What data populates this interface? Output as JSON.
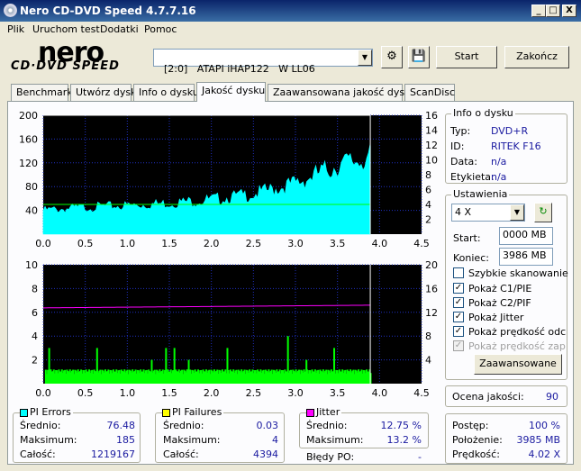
{
  "window": {
    "title": "Nero CD-DVD Speed 4.7.7.16",
    "btn_min": "_",
    "btn_max": "□",
    "btn_close": "X"
  },
  "menu": [
    "Plik",
    "Uruchom test",
    "Dodatki",
    "Pomoc"
  ],
  "logo": {
    "text": "nero",
    "subtext": "CD·DVD SPEED"
  },
  "toolbar": {
    "drive": "[2:0]   ATAPI iHAP122   W LL06",
    "start": "Start",
    "stop": "Zakończ"
  },
  "tabs": [
    "Benchmark",
    "Utwórz dysk",
    "Info o dysku",
    "Jakość dysku",
    "Zaawansowana jakość dysku",
    "ScanDisc"
  ],
  "active_tab": "Jakość dysku",
  "disc_info": {
    "title": "Info o dysku",
    "rows": [
      {
        "label": "Typ:",
        "value": "DVD+R"
      },
      {
        "label": "ID:",
        "value": "RITEK F16"
      },
      {
        "label": "Data:",
        "value": "n/a"
      },
      {
        "label": "Etykieta:",
        "value": "n/a"
      }
    ]
  },
  "settings": {
    "title": "Ustawienia",
    "speed": "4 X",
    "start_label": "Start:",
    "start_value": "0000 MB",
    "end_label": "Koniec:",
    "end_value": "3986 MB",
    "checks": [
      {
        "label": "Szybkie skanowanie",
        "checked": false,
        "disabled": false
      },
      {
        "label": "Pokaż C1/PIE",
        "checked": true,
        "disabled": false
      },
      {
        "label": "Pokaż C2/PIF",
        "checked": true,
        "disabled": false
      },
      {
        "label": "Pokaż Jitter",
        "checked": true,
        "disabled": false
      },
      {
        "label": "Pokaż prędkość odczy",
        "checked": true,
        "disabled": false
      },
      {
        "label": "Pokaż prędkość zapisu",
        "checked": true,
        "disabled": true
      }
    ],
    "advanced": "Zaawansowane"
  },
  "quality": {
    "label": "Ocena jakości:",
    "value": "90"
  },
  "progress": {
    "rows": [
      {
        "label": "Postęp:",
        "value": "100 %"
      },
      {
        "label": "Położenie:",
        "value": "3985 MB"
      },
      {
        "label": "Prędkość:",
        "value": "4.02 X"
      }
    ]
  },
  "pi_errors": {
    "title": "PI Errors",
    "color": "#00ffff",
    "rows": [
      {
        "label": "Średnio:",
        "value": "76.48"
      },
      {
        "label": "Maksimum:",
        "value": "185"
      },
      {
        "label": "Całość:",
        "value": "1219167"
      }
    ]
  },
  "pi_failures": {
    "title": "PI Failures",
    "color": "#ffff00",
    "rows": [
      {
        "label": "Średnio:",
        "value": "0.03"
      },
      {
        "label": "Maksimum:",
        "value": "4"
      },
      {
        "label": "Całość:",
        "value": "4394"
      }
    ]
  },
  "jitter": {
    "title": "Jitter",
    "color": "#ff00ff",
    "rows": [
      {
        "label": "Średnio:",
        "value": "12.75 %"
      },
      {
        "label": "Maksimum:",
        "value": "13.2 %"
      }
    ],
    "po_label": "Błędy PO:",
    "po_value": "-"
  },
  "chart_data": [
    {
      "type": "area",
      "x_ticks": [
        "0.0",
        "0.5",
        "1.0",
        "1.5",
        "2.0",
        "2.5",
        "3.0",
        "3.5",
        "4.0",
        "4.5"
      ],
      "y_left_ticks": [
        "200",
        "160",
        "120",
        "80",
        "40"
      ],
      "y_right_ticks": [
        "16",
        "14",
        "12",
        "10",
        "8",
        "6",
        "4",
        "2"
      ],
      "xlim": [
        0,
        4.5
      ],
      "ylim": [
        0,
        200
      ],
      "y2lim": [
        0,
        16
      ],
      "grid": true,
      "series": [
        {
          "type": "area",
          "color": "#00ffff",
          "x": [
            0,
            0.5,
            1.0,
            1.5,
            2.0,
            2.5,
            3.0,
            3.5,
            3.89
          ],
          "y": [
            40,
            45,
            48,
            52,
            58,
            67,
            85,
            115,
            130
          ]
        },
        {
          "type": "line",
          "color": "#00ff00",
          "axis": "right",
          "x": [
            0,
            3.89
          ],
          "y": [
            4,
            4
          ]
        },
        {
          "type": "line",
          "color": "#ffffff",
          "axis": "right",
          "x": [
            0,
            3.89
          ],
          "y": [
            16,
            16
          ]
        }
      ]
    },
    {
      "type": "bar",
      "x_ticks": [
        "0.0",
        "0.5",
        "1.0",
        "1.5",
        "2.0",
        "2.5",
        "3.0",
        "3.5",
        "4.0",
        "4.5"
      ],
      "y_left_ticks": [
        "10",
        "8",
        "6",
        "4",
        "2"
      ],
      "y_right_ticks": [
        "20",
        "16",
        "12",
        "8",
        "4"
      ],
      "xlim": [
        0,
        4.5
      ],
      "ylim": [
        0,
        10
      ],
      "y2lim": [
        0,
        20
      ],
      "grid": true,
      "series": [
        {
          "type": "bar",
          "color": "#00ff00",
          "x": [
            0.06,
            0.63,
            1.28,
            1.45,
            1.55,
            1.72,
            2.18,
            2.9,
            3.12,
            3.45
          ],
          "y": [
            3,
            3,
            2,
            3,
            3,
            2,
            3,
            4,
            2,
            3
          ]
        },
        {
          "type": "line",
          "color": "#ff00ff",
          "axis": "right",
          "x": [
            0,
            3.89
          ],
          "y": [
            12.75,
            13.2
          ]
        }
      ]
    }
  ]
}
